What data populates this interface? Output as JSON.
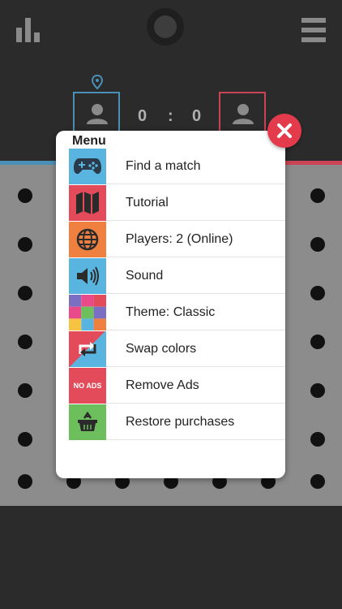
{
  "header": {
    "stats_icon": "bar-chart-icon",
    "menu_icon": "hamburger-icon",
    "score_left": "0",
    "score_sep": ":",
    "score_right": "0"
  },
  "menu": {
    "title": "Menu",
    "items": [
      {
        "label": "Find a match",
        "icon": "gamepad-icon",
        "color": "#5ab4e0"
      },
      {
        "label": "Tutorial",
        "icon": "map-icon",
        "color": "#e34b5a"
      },
      {
        "label": "Players: 2 (Online)",
        "icon": "globe-icon",
        "color": "#f08040"
      },
      {
        "label": "Sound",
        "icon": "speaker-icon",
        "color": "#5ab4e0"
      },
      {
        "label": "Theme: Classic",
        "icon": "palette-icon",
        "color": "#f6c344"
      },
      {
        "label": "Swap colors",
        "icon": "swap-icon",
        "color": "#e34b5a"
      },
      {
        "label": "Remove Ads",
        "icon": "no-ads-icon",
        "color": "#e34b5a",
        "icon_text": "NO ADS"
      },
      {
        "label": "Restore purchases",
        "icon": "basket-icon",
        "color": "#6dbf5e"
      }
    ]
  },
  "colors": {
    "blue": "#4a90b6",
    "red": "#c94455",
    "close": "#e33b4c"
  }
}
